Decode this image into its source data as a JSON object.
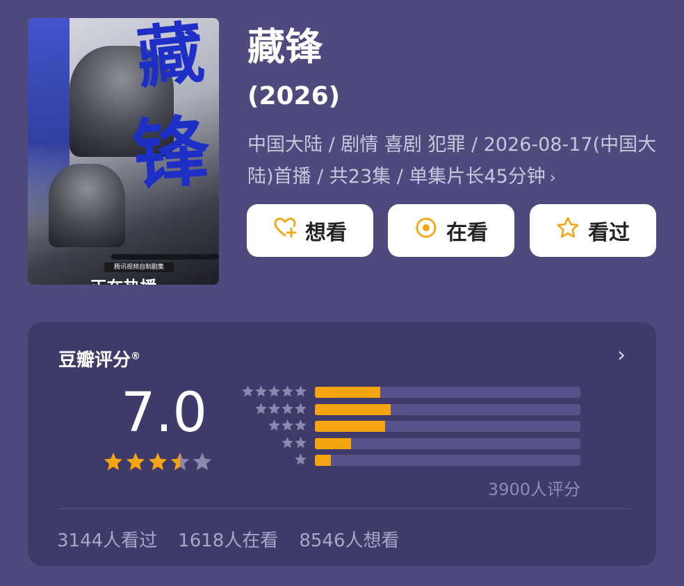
{
  "poster": {
    "title_chars": [
      "藏",
      "锋"
    ],
    "badge": "腾讯视频自制剧集",
    "status": "正在热播"
  },
  "show": {
    "title": "藏锋",
    "year": "(2026)",
    "meta_line": "中国大陆 / 剧情 喜剧 犯罪 / 2026-08-17(中国大陆)首播 / 共23集 / 单集片长45分钟",
    "chevron": "›"
  },
  "actions": {
    "want": {
      "label": "想看",
      "icon": "heart-plus-icon"
    },
    "watching": {
      "label": "在看",
      "icon": "target-icon"
    },
    "watched": {
      "label": "看过",
      "icon": "star-outline-icon"
    }
  },
  "rating": {
    "section_title": "豆瓣评分",
    "registered_mark": "®",
    "score": "7.0",
    "stars_value": 3.5,
    "stars_max": 5,
    "distribution": [
      {
        "stars": 5,
        "fraction": 0.245
      },
      {
        "stars": 4,
        "fraction": 0.285
      },
      {
        "stars": 3,
        "fraction": 0.265
      },
      {
        "stars": 2,
        "fraction": 0.135
      },
      {
        "stars": 1,
        "fraction": 0.06
      }
    ],
    "count_label": "3900人评分",
    "chevron": "›"
  },
  "stats": {
    "watched": "3144人看过",
    "watching": "1618人在看",
    "want": "8546人想看"
  },
  "colors": {
    "background": "#4e4a7e",
    "card": "#3e3a6a",
    "accent": "#f5a40f",
    "bar_track": "#56528a",
    "dim_star": "#8c88ad"
  }
}
